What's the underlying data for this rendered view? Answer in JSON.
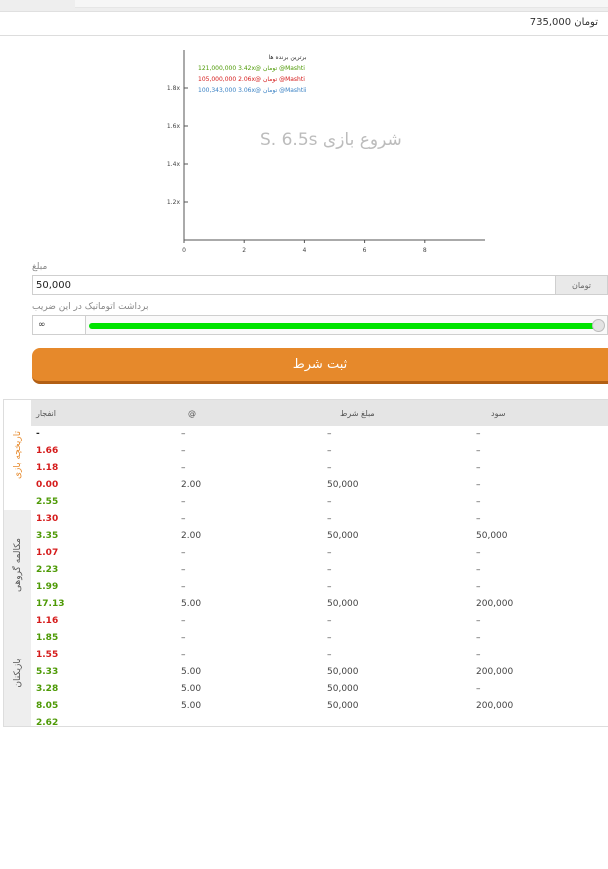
{
  "header": {
    "balance": "735,000",
    "currency": "تومان"
  },
  "chart_data": {
    "type": "line",
    "watermark": "شروع بازی S. 6.5s",
    "x_ticks": [
      "0",
      "2",
      "4",
      "6",
      "8"
    ],
    "y_ticks": [
      "1.2x",
      "1.4x",
      "1.6x",
      "1.8x"
    ],
    "xlim": [
      0,
      10
    ],
    "ylim": [
      1.0,
      2.0
    ],
    "series": [],
    "top_winners": {
      "title": "برترین برنده ها",
      "rows": [
        {
          "user": "@Mashti",
          "currency": "تومان",
          "multiplier": "3.42x@",
          "amount": "121,000,000",
          "color": "#4e9a06"
        },
        {
          "user": "@Mashti",
          "currency": "تومان",
          "multiplier": "2.06x@",
          "amount": "105,000,000",
          "color": "#d51b1b"
        },
        {
          "user": "@Mashtii",
          "currency": "تومان",
          "multiplier": "3.06x@",
          "amount": "100,343,000",
          "color": "#3b82c4"
        }
      ]
    }
  },
  "bet_form": {
    "amount_label": "مبلغ",
    "amount_value": "50,000",
    "currency": "تومان",
    "auto_label": "برداشت اتوماتیک در این ضریب",
    "auto_value": "∞",
    "slider_fraction": 1.0,
    "slider_color": "#00e400",
    "submit_label": "ثبت شرط",
    "submit_color": "#e6892b"
  },
  "tabs": [
    {
      "label": "تاریخچه بازی",
      "active": true
    },
    {
      "label": "مکالمه گروهی",
      "active": false
    },
    {
      "label": "بازیکنان",
      "active": false
    }
  ],
  "history": {
    "columns": [
      "انفجار",
      "@",
      "مبلغ شرط",
      "سود"
    ],
    "rows": [
      {
        "crash": "-",
        "color": "black",
        "at": "–",
        "amount": "–",
        "profit": "–"
      },
      {
        "crash": "1.66",
        "color": "red",
        "at": "–",
        "amount": "–",
        "profit": "–"
      },
      {
        "crash": "1.18",
        "color": "red",
        "at": "–",
        "amount": "–",
        "profit": "–"
      },
      {
        "crash": "0.00",
        "color": "red",
        "at": "2.00",
        "amount": "50,000",
        "profit": "–"
      },
      {
        "crash": "2.55",
        "color": "green",
        "at": "–",
        "amount": "–",
        "profit": "–"
      },
      {
        "crash": "1.30",
        "color": "red",
        "at": "–",
        "amount": "–",
        "profit": "–"
      },
      {
        "crash": "3.35",
        "color": "green",
        "at": "2.00",
        "amount": "50,000",
        "profit": "50,000"
      },
      {
        "crash": "1.07",
        "color": "red",
        "at": "–",
        "amount": "–",
        "profit": "–"
      },
      {
        "crash": "2.23",
        "color": "green",
        "at": "–",
        "amount": "–",
        "profit": "–"
      },
      {
        "crash": "1.99",
        "color": "green",
        "at": "–",
        "amount": "–",
        "profit": "–"
      },
      {
        "crash": "17.13",
        "color": "green",
        "at": "5.00",
        "amount": "50,000",
        "profit": "200,000"
      },
      {
        "crash": "1.16",
        "color": "red",
        "at": "–",
        "amount": "–",
        "profit": "–"
      },
      {
        "crash": "1.85",
        "color": "green",
        "at": "–",
        "amount": "–",
        "profit": "–"
      },
      {
        "crash": "1.55",
        "color": "red",
        "at": "–",
        "amount": "–",
        "profit": "–"
      },
      {
        "crash": "5.33",
        "color": "green",
        "at": "5.00",
        "amount": "50,000",
        "profit": "200,000"
      },
      {
        "crash": "3.28",
        "color": "green",
        "at": "5.00",
        "amount": "50,000",
        "profit": "–"
      },
      {
        "crash": "8.05",
        "color": "green",
        "at": "5.00",
        "amount": "50,000",
        "profit": "200,000"
      },
      {
        "crash": "2.62",
        "color": "green",
        "at": "",
        "amount": "",
        "profit": ""
      }
    ]
  }
}
